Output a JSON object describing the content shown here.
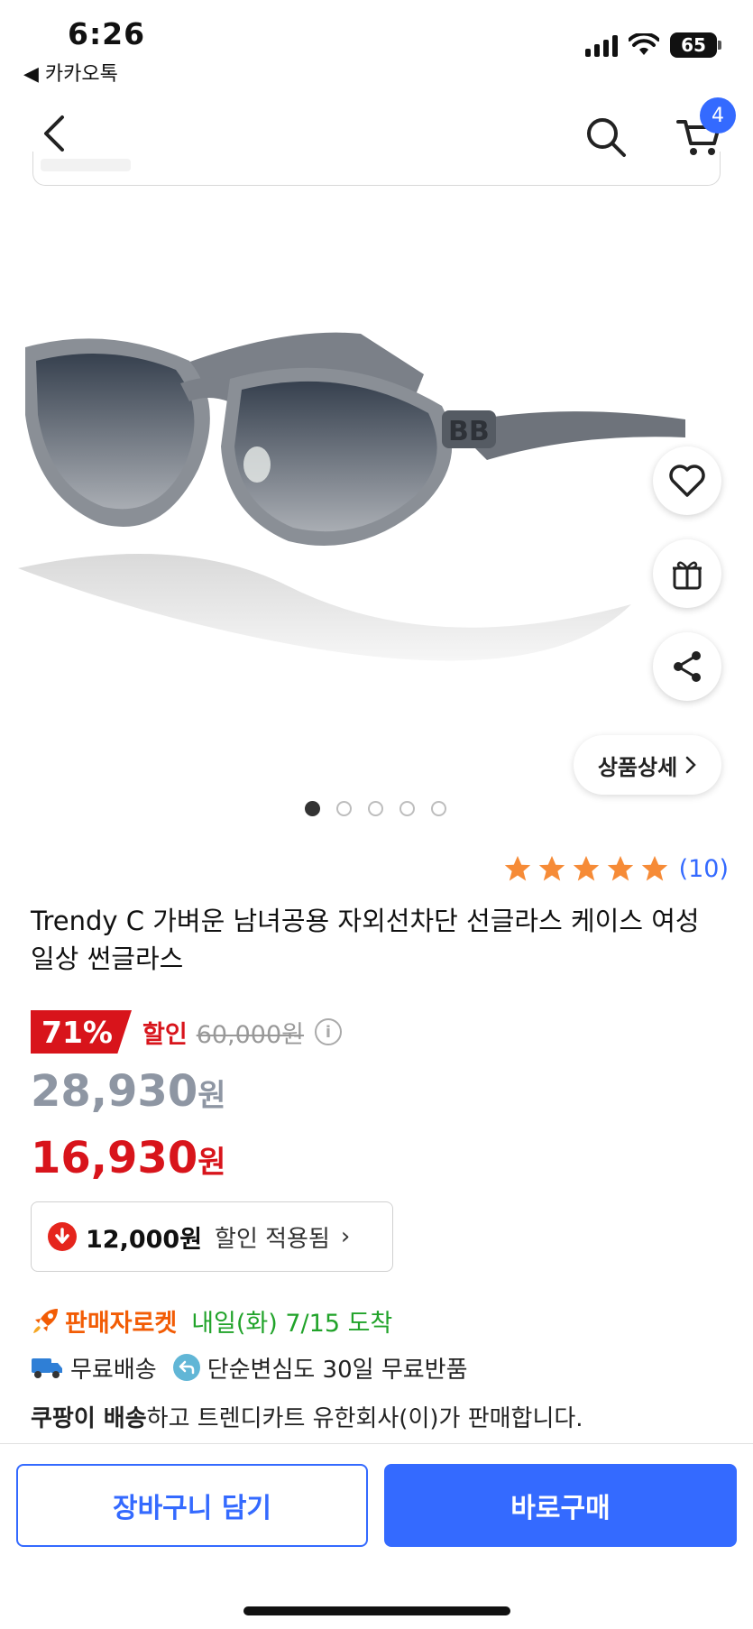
{
  "status_bar": {
    "time": "6:26",
    "back_app": "◀ 카카오톡",
    "battery": "65"
  },
  "nav": {
    "cart_count": "4"
  },
  "image": {
    "current_index": 1,
    "total": 5
  },
  "side_actions": {
    "detail_label": "상품상세"
  },
  "product": {
    "rating_stars": 5,
    "review_count": "(10)",
    "title": "Trendy C 가벼운 남녀공용 자외선차단 선글라스 케이스 여성 일상 썬글라스"
  },
  "pricing": {
    "discount_percent": "71%",
    "discount_label": "할인",
    "original_price": "60,000원",
    "sale_price_value": "28,930",
    "final_price_value": "16,930",
    "won": "원"
  },
  "coupon": {
    "amount": "12,000원",
    "text": "할인 적용됨",
    "chevron": "›"
  },
  "delivery": {
    "rocket_label": "판매자로켓",
    "arrival": "내일(화) 7/15 도착",
    "shipping": "무료배송",
    "return_policy": "단순변심도 30일 무료반품",
    "seller_bold": "쿠팡이 배송",
    "seller_rest": "하고 트렌디카트 유한회사(이)가 판매합니다."
  },
  "actions": {
    "add_to_cart": "장바구니 담기",
    "buy_now": "바로구매"
  },
  "colors": {
    "brand_blue": "#346aff",
    "discount_red": "#d8141b",
    "rocket_orange": "#f25c05",
    "arrival_green": "#21a32a",
    "star_orange": "#f68b37"
  },
  "icons": {
    "back": "chevron-left-icon",
    "search": "search-icon",
    "cart": "cart-icon",
    "wishlist": "heart-icon",
    "gift": "gift-icon",
    "share": "share-icon",
    "coupon": "down-arrow-circle-icon",
    "rocket": "rocket-icon",
    "truck": "truck-icon",
    "return": "return-arrow-icon",
    "info": "info-icon"
  }
}
